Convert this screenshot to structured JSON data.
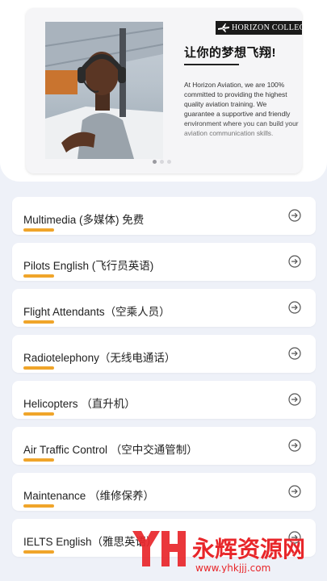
{
  "banner": {
    "logo_text": "HORIZON COLLEGE",
    "title": "让你的梦想飞翔!",
    "description": "At Horizon Aviation, we are 100% committed to providing the highest quality aviation training. We guarantee a supportive and friendly environment where you can build your aviation communication skills.",
    "slide_index": 1,
    "slide_count": 3
  },
  "courses": [
    {
      "label": "Multimedia (多媒体) 免费"
    },
    {
      "label": "Pilots English (飞行员英语)"
    },
    {
      "label": "Flight Attendants（空乘人员）"
    },
    {
      "label": "Radiotelephony（无线电通话）"
    },
    {
      "label": "Helicopters （直升机）"
    },
    {
      "label": "Air Traffic Control （空中交通管制）"
    },
    {
      "label": "Maintenance （维修保养）"
    },
    {
      "label": "IELTS English（雅思英语）"
    }
  ],
  "watermark": {
    "brand": "永辉资源网",
    "url": "www.yhkjjj.com"
  },
  "colors": {
    "accent_orange": "#f0a52a",
    "progress_red": "#f05a40",
    "background": "#eef1f8",
    "watermark_red": "#e8262a"
  },
  "icons": {
    "course_arrow": "arrow-right-circle-icon"
  }
}
